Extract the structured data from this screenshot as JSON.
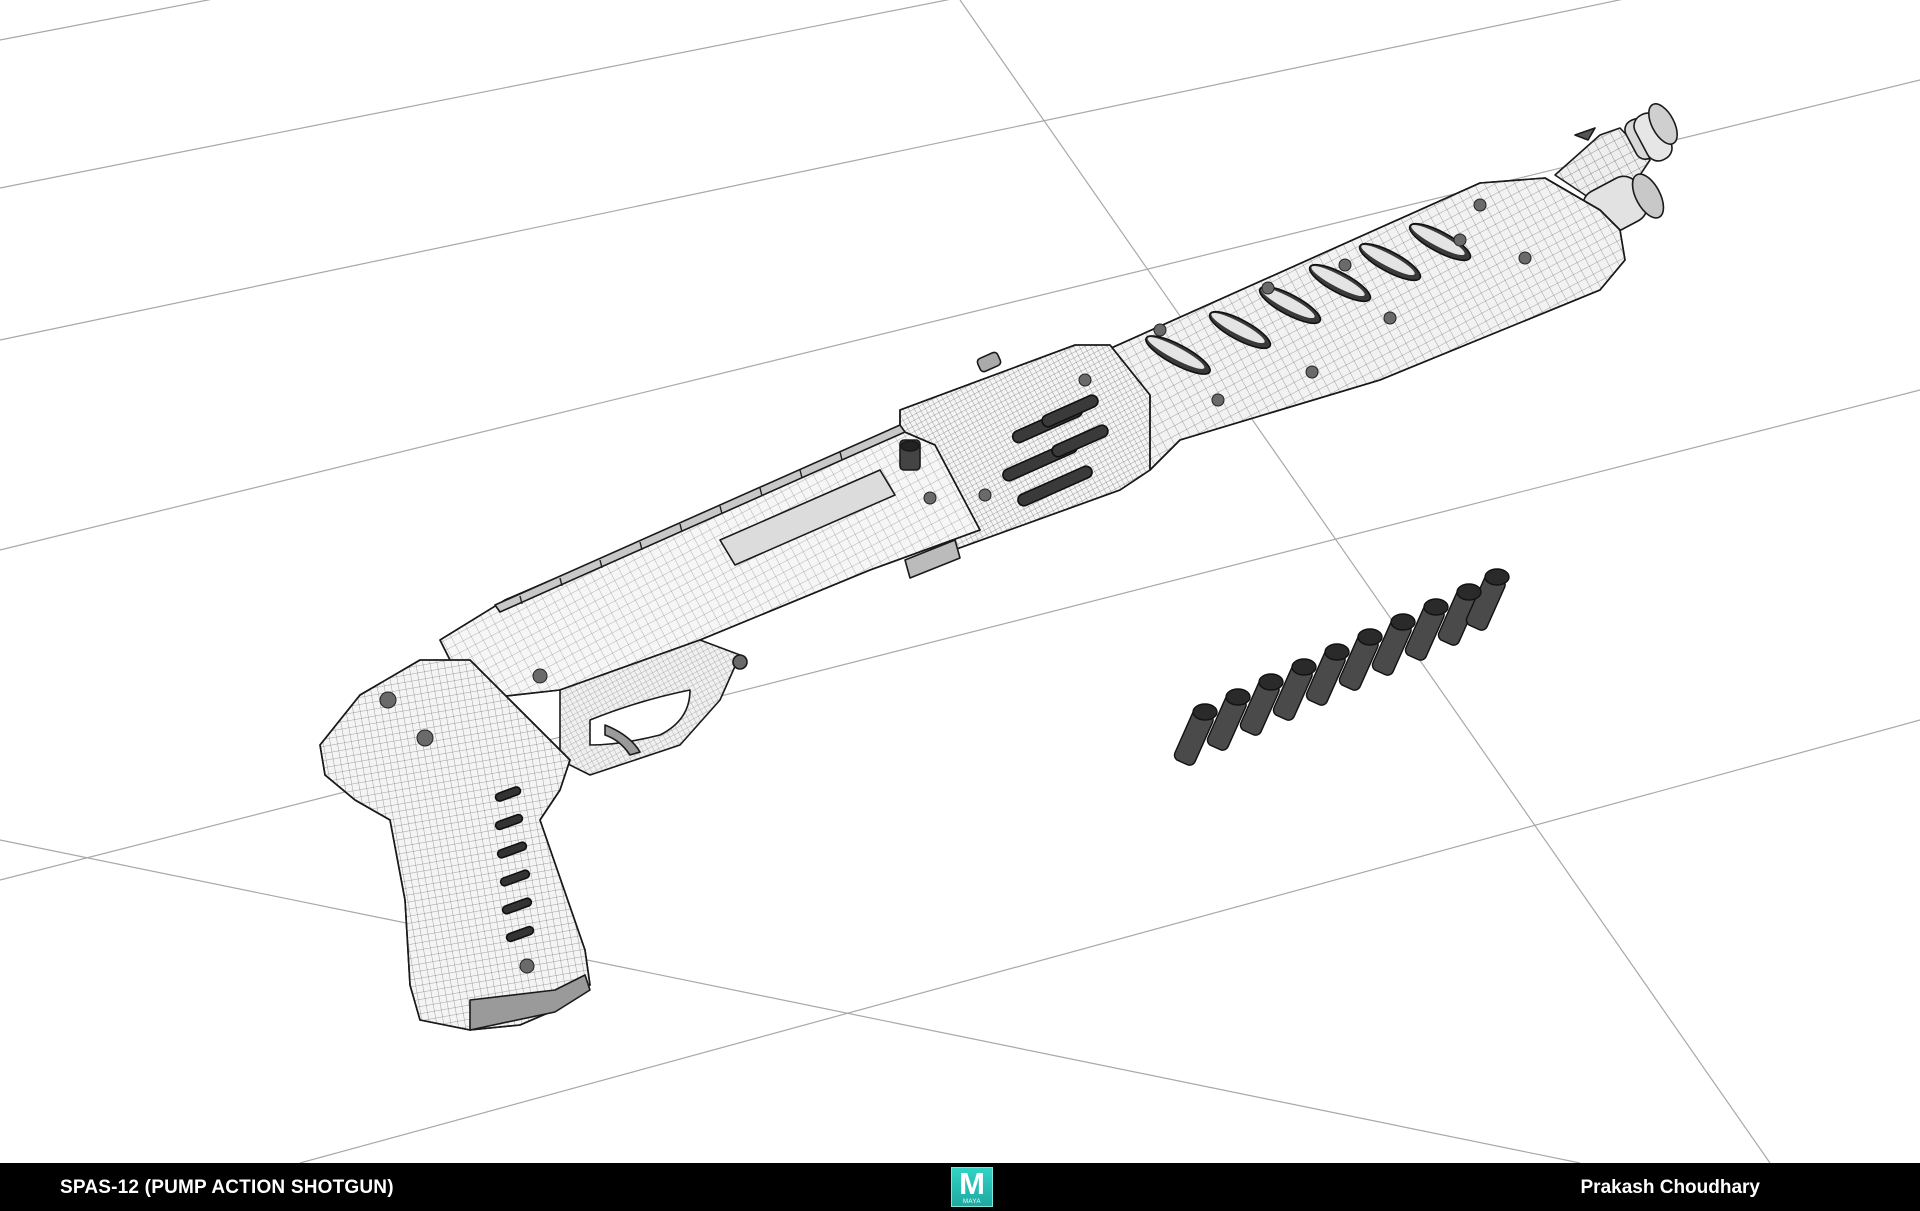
{
  "render": {
    "subject": "SPAS-12 shotgun wireframe model"
  },
  "footer": {
    "title": "SPAS-12 (PUMP ACTION SHOTGUN)",
    "author": "Prakash Choudhary",
    "logo": {
      "letter": "M",
      "caption": "MAYA",
      "icon": "maya-logo-icon",
      "color": "#25bdb4"
    },
    "background_color": "#000000",
    "text_color": "#ffffff"
  }
}
